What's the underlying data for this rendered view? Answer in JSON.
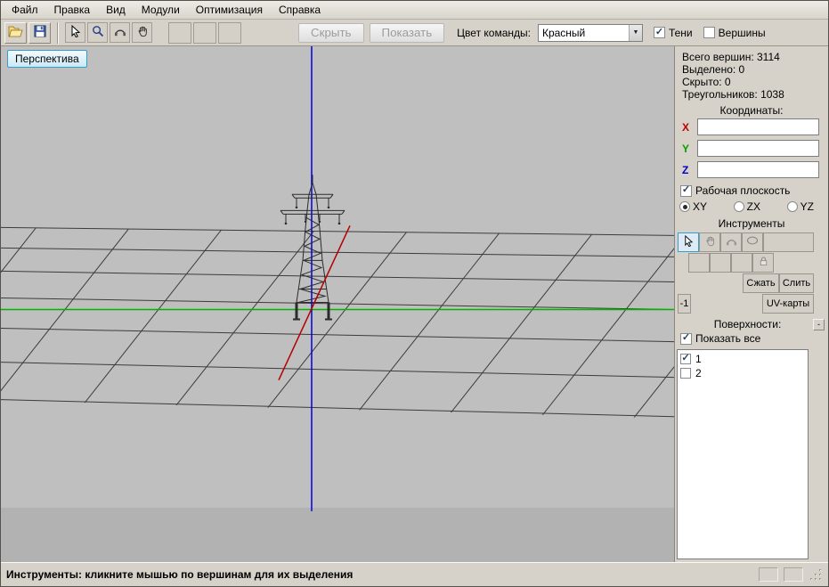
{
  "menu": {
    "items": [
      {
        "label": "Файл"
      },
      {
        "label": "Правка"
      },
      {
        "label": "Вид"
      },
      {
        "label": "Модули"
      },
      {
        "label": "Оптимизация"
      },
      {
        "label": "Справка"
      }
    ]
  },
  "toolbar": {
    "hide_button": "Скрыть",
    "show_button": "Показать",
    "team_color_label": "Цвет команды:",
    "team_color_value": "Красный",
    "shadows_checkbox": "Тени",
    "vertices_checkbox": "Вершины"
  },
  "viewport": {
    "perspective_button": "Перспектива"
  },
  "panel": {
    "stats": {
      "vertices_total": "Всего вершин: 3114",
      "selected": "Выделено: 0",
      "hidden": "Скрыто: 0",
      "triangles": "Треугольников: 1038"
    },
    "coordinates_label": "Координаты:",
    "axis_x": "X",
    "axis_y": "Y",
    "axis_z": "Z",
    "coord_x_value": "",
    "coord_y_value": "",
    "coord_z_value": "",
    "work_plane_label": "Рабочая плоскость",
    "plane_xy": "XY",
    "plane_zx": "ZX",
    "plane_yz": "YZ",
    "tools_label": "Инструменты",
    "compress_button": "Сжать",
    "merge_button": "Слить",
    "minus_one_button": "-1",
    "uv_maps_button": "UV-карты",
    "surfaces_label": "Поверхности:",
    "surfaces_options_button": "-",
    "show_all_label": "Показать все",
    "surfaces": [
      {
        "label": "1",
        "checked": true
      },
      {
        "label": "2",
        "checked": false
      }
    ]
  },
  "statusbar": {
    "message": "Инструменты: кликните мышью по вершинам для их выделения"
  },
  "colors": {
    "axis_x_line": "#b40000",
    "axis_y_line": "#00b400",
    "axis_z_line": "#0000dc",
    "viewport_bg": "#bfbfbf",
    "grid_line": "#3c3c3c"
  },
  "icons": {
    "open": "open-folder-icon",
    "save": "floppy-disk-icon",
    "select": "cursor-arrow-icon",
    "zoom": "magnifier-icon",
    "rotate": "orbit-icon",
    "pan": "hand-icon",
    "lock": "padlock-icon",
    "ellipse": "ellipse-icon",
    "dropdown_arrow": "chevron-down-icon"
  }
}
